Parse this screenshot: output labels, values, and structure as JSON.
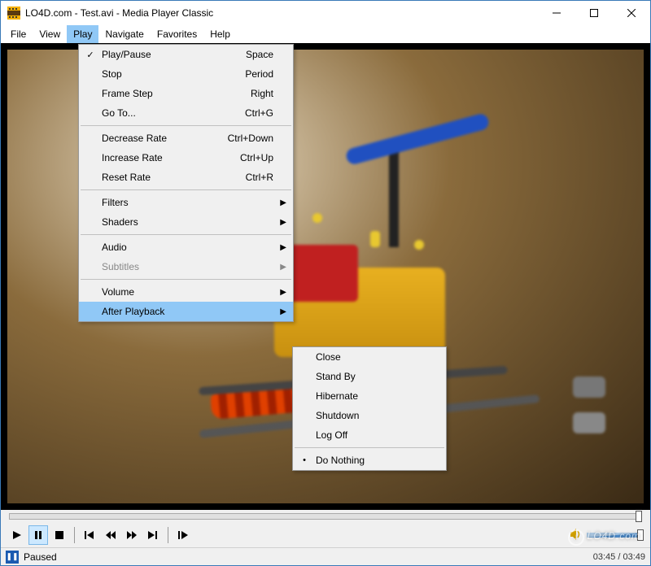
{
  "titlebar": {
    "text": "LO4D.com - Test.avi - Media Player Classic"
  },
  "menubar": {
    "items": [
      "File",
      "View",
      "Play",
      "Navigate",
      "Favorites",
      "Help"
    ],
    "activeIndex": 2
  },
  "play_menu": {
    "items": [
      {
        "check": "✓",
        "label": "Play/Pause",
        "shortcut": "Space"
      },
      {
        "check": "",
        "label": "Stop",
        "shortcut": "Period"
      },
      {
        "check": "",
        "label": "Frame Step",
        "shortcut": "Right"
      },
      {
        "check": "",
        "label": "Go To...",
        "shortcut": "Ctrl+G"
      },
      {
        "sep": true
      },
      {
        "check": "",
        "label": "Decrease Rate",
        "shortcut": "Ctrl+Down"
      },
      {
        "check": "",
        "label": "Increase Rate",
        "shortcut": "Ctrl+Up"
      },
      {
        "check": "",
        "label": "Reset Rate",
        "shortcut": "Ctrl+R"
      },
      {
        "sep": true
      },
      {
        "check": "",
        "label": "Filters",
        "shortcut": "",
        "sub": true
      },
      {
        "check": "",
        "label": "Shaders",
        "shortcut": "",
        "sub": true
      },
      {
        "sep": true
      },
      {
        "check": "",
        "label": "Audio",
        "shortcut": "",
        "sub": true
      },
      {
        "check": "",
        "label": "Subtitles",
        "shortcut": "",
        "sub": true,
        "disabled": true
      },
      {
        "sep": true
      },
      {
        "check": "",
        "label": "Volume",
        "shortcut": "",
        "sub": true
      },
      {
        "check": "",
        "label": "After Playback",
        "shortcut": "",
        "sub": true,
        "highlight": true
      }
    ]
  },
  "after_playback_menu": {
    "items": [
      {
        "check": "",
        "label": "Close"
      },
      {
        "check": "",
        "label": "Stand By"
      },
      {
        "check": "",
        "label": "Hibernate"
      },
      {
        "check": "",
        "label": "Shutdown"
      },
      {
        "check": "",
        "label": "Log Off"
      },
      {
        "sep": true
      },
      {
        "check": "•",
        "label": "Do Nothing"
      }
    ]
  },
  "status": {
    "text": "Paused",
    "time": "03:45 / 03:49"
  },
  "watermark": "LO4D.com"
}
